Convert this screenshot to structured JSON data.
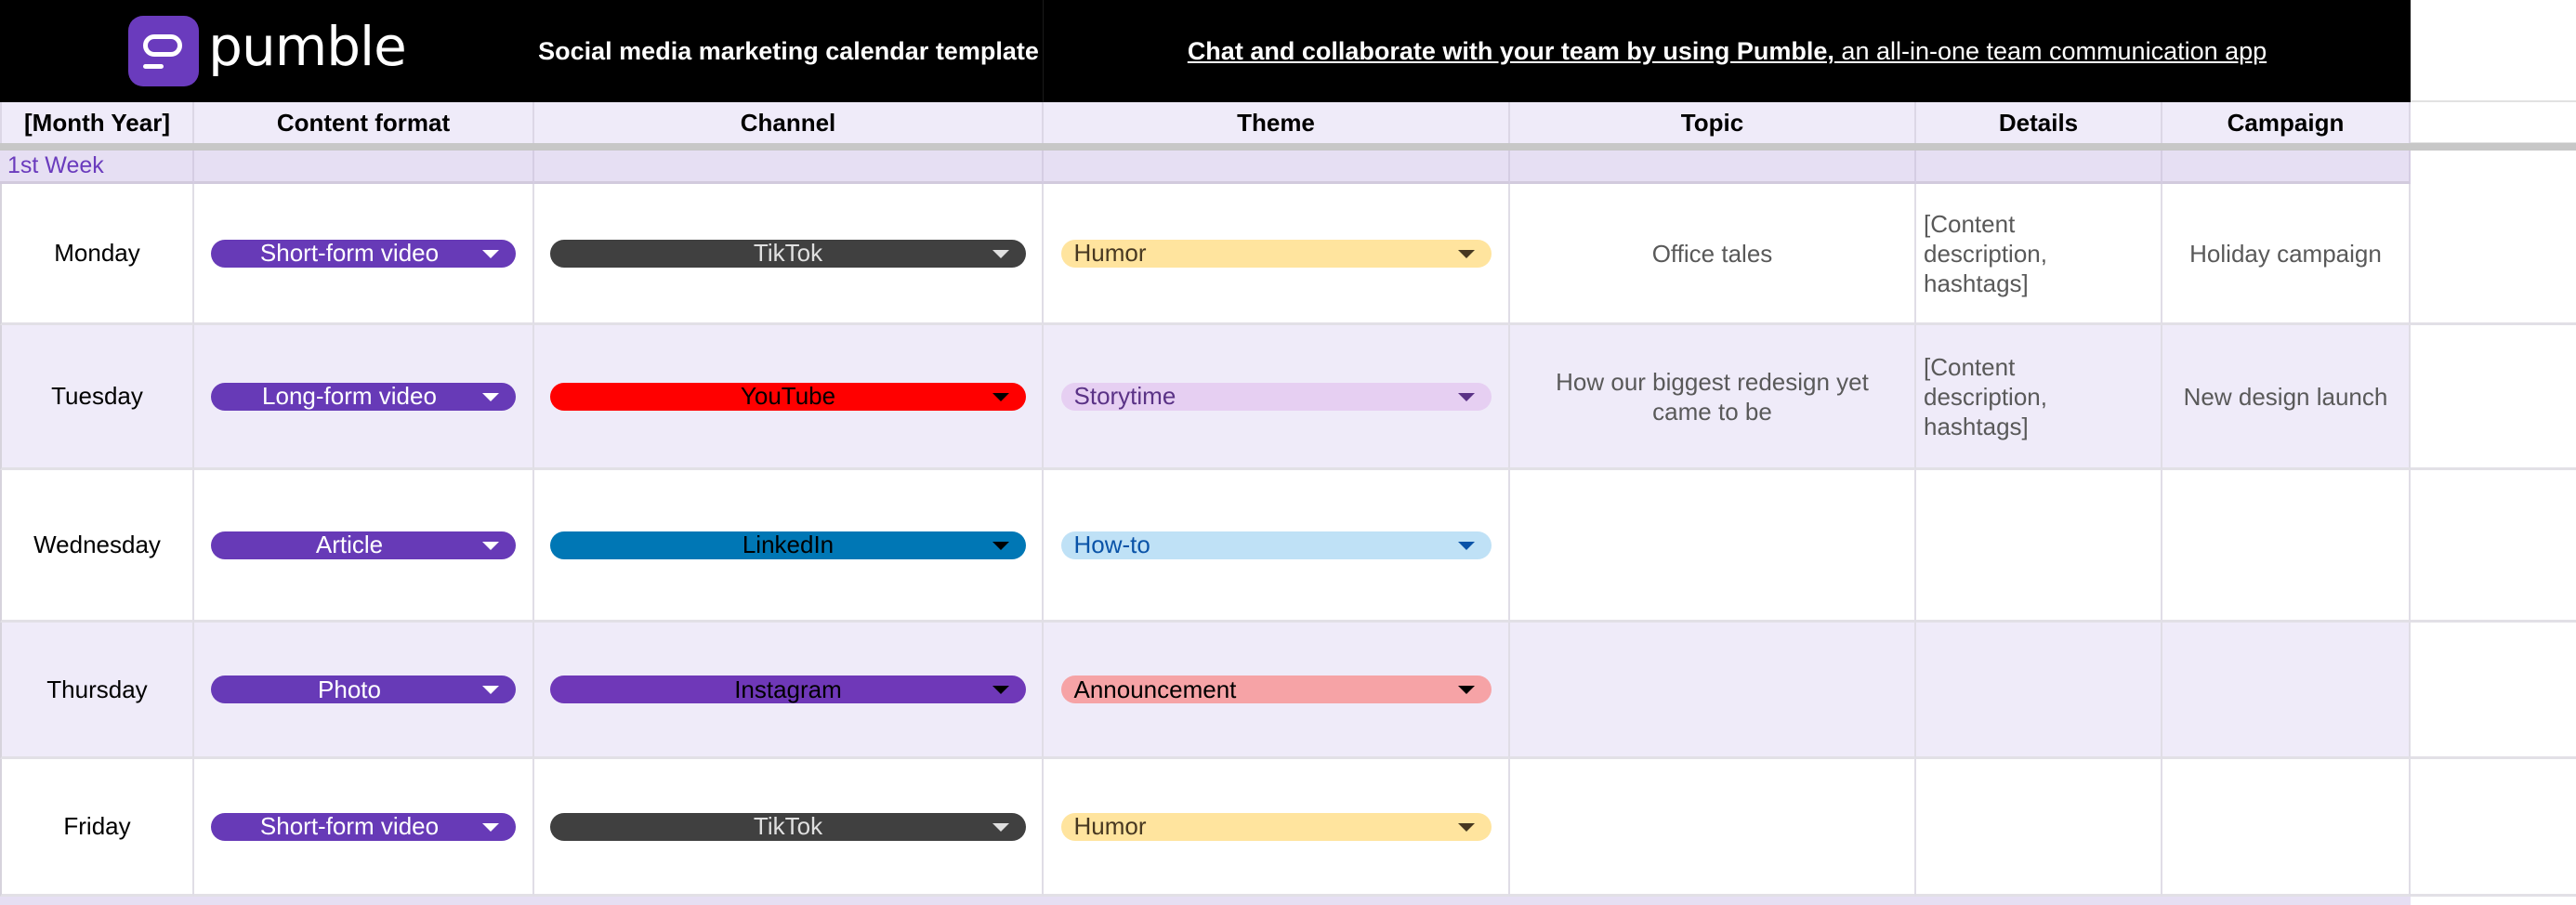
{
  "header": {
    "logo_text": "pumble",
    "title": "Social media marketing calendar template",
    "promo_bold": "Chat and collaborate with your team by using Pumble,",
    "promo_rest": " an all-in-one team communication app"
  },
  "columns": [
    "[Month Year]",
    "Content format",
    "Channel",
    "Theme",
    "Topic",
    "Details",
    "Campaign"
  ],
  "week_label": "1st Week",
  "rows": [
    {
      "day": "Monday",
      "format": "Short-form video",
      "channel": "TikTok",
      "channel_bg": "#404040",
      "channel_fg": "#e0e0e0",
      "theme": "Humor",
      "theme_bg": "#ffe49e",
      "theme_fg": "#473821",
      "topic": "Office tales",
      "details": "[Content description, hashtags]",
      "campaign": "Holiday campaign"
    },
    {
      "day": "Tuesday",
      "format": "Long-form video",
      "channel": "YouTube",
      "channel_bg": "#ff0000",
      "channel_fg": "#000000",
      "theme": "Storytime",
      "theme_bg": "#e6cff2",
      "theme_fg": "#5a3286",
      "topic": "How our biggest redesign yet came to be",
      "details": "[Content description, hashtags]",
      "campaign": "New design launch"
    },
    {
      "day": "Wednesday",
      "format": "Article",
      "channel": "LinkedIn",
      "channel_bg": "#0077b5",
      "channel_fg": "#000000",
      "theme": "How-to",
      "theme_bg": "#bfe1f6",
      "theme_fg": "#0a53a8",
      "topic": "",
      "details": "",
      "campaign": ""
    },
    {
      "day": "Thursday",
      "format": "Photo",
      "channel": "Instagram",
      "channel_bg": "#6f38b8",
      "channel_fg": "#000000",
      "theme": "Announcement",
      "theme_bg": "#f6a3a6",
      "theme_fg": "#000000",
      "topic": "",
      "details": "",
      "campaign": ""
    },
    {
      "day": "Friday",
      "format": "Short-form video",
      "channel": "TikTok",
      "channel_bg": "#404040",
      "channel_fg": "#e0e0e0",
      "theme": "Humor",
      "theme_bg": "#ffe49e",
      "theme_fg": "#473821",
      "topic": "",
      "details": "",
      "campaign": ""
    }
  ],
  "colors": {
    "brand": "#6a3bbd",
    "format_pill": "#673ab7",
    "header_bg": "#000000",
    "row_alt": "#efebf9",
    "week_bg": "#e6dff3"
  }
}
